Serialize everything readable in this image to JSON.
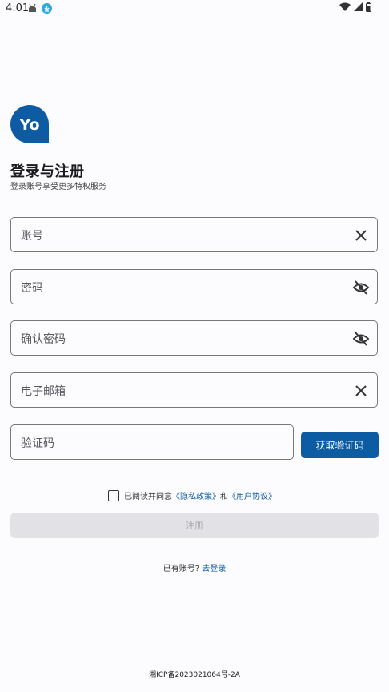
{
  "status_bar": {
    "time": "4:01",
    "icons_left": [
      "android-icon",
      "download-icon"
    ],
    "icons_right": [
      "wifi-icon",
      "signal-icon",
      "battery-icon"
    ]
  },
  "brand": {
    "logo_text": "Yo",
    "color": "#0c5ba3"
  },
  "header": {
    "title": "登录与注册",
    "subtitle": "登录账号享受更多特权服务"
  },
  "form": {
    "account_label": "账号",
    "password_label": "密码",
    "confirm_password_label": "确认密码",
    "email_label": "电子邮箱",
    "code_label": "验证码",
    "get_code_button": "获取验证码"
  },
  "agreement": {
    "prefix": "已阅读并同意",
    "privacy": "《隐私政策》",
    "and": "和",
    "terms": "《用户协议》",
    "checked": false
  },
  "register_button": "注册",
  "login_prompt": {
    "text": "已有账号?",
    "link": "去登录"
  },
  "footer": "湘ICP备2023021064号-2A"
}
